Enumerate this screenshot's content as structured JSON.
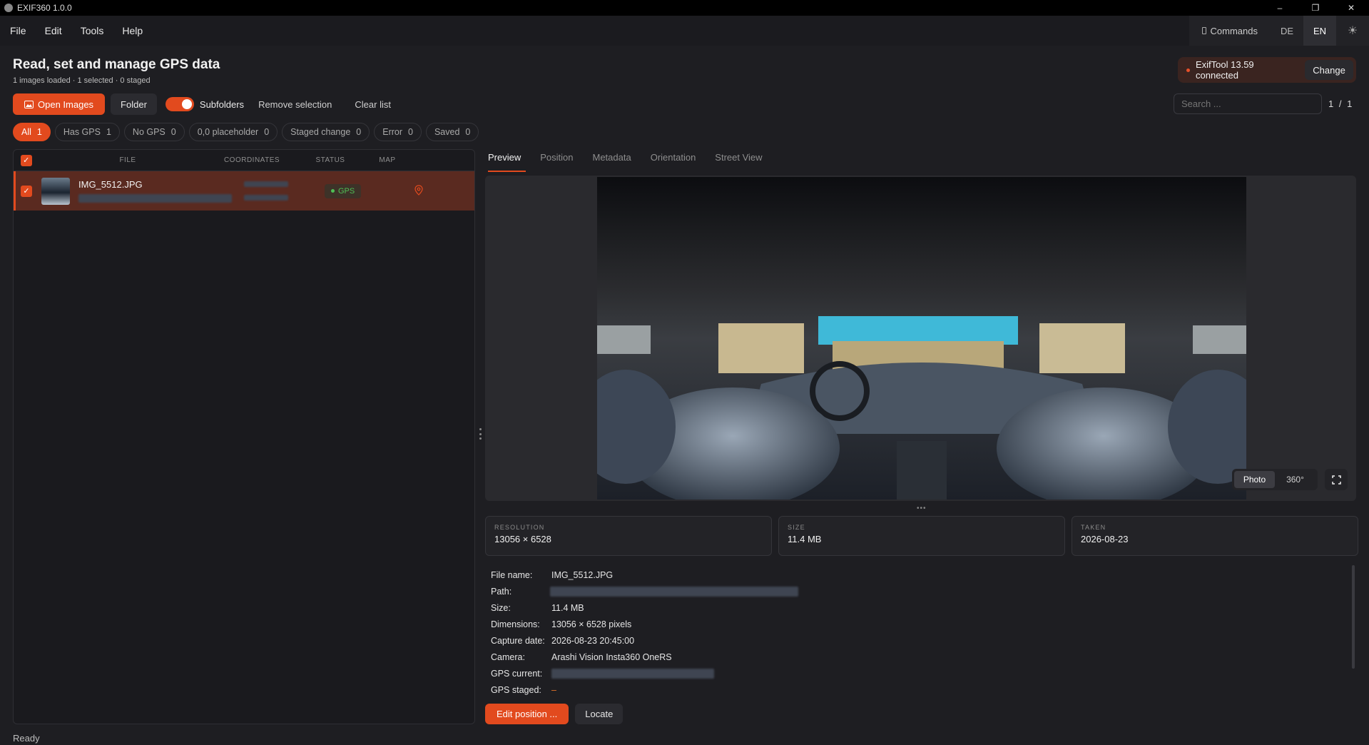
{
  "window": {
    "title": "EXIF360 1.0.0",
    "controls": [
      "–",
      "❐",
      "✕"
    ]
  },
  "menu": [
    "File",
    "Edit",
    "Tools",
    "Help"
  ],
  "topbar": {
    "commands_label": "Commands",
    "languages": [
      "DE",
      "EN"
    ],
    "active_language": "EN"
  },
  "page": {
    "title": "Read, set and manage GPS data",
    "subtitle": "1 images loaded · 1 selected · 0 staged"
  },
  "exiftool": {
    "status": "ExifTool 13.59 connected",
    "change_label": "Change"
  },
  "toolbar": {
    "open_images": "Open Images",
    "folder": "Folder",
    "subfolders": "Subfolders",
    "subfolders_on": true,
    "remove_selection": "Remove selection",
    "clear_list": "Clear list"
  },
  "search": {
    "placeholder": "Search ...",
    "pager": "1 / 1"
  },
  "filters": [
    {
      "label": "All",
      "count": "1",
      "active": true
    },
    {
      "label": "Has GPS",
      "count": "1"
    },
    {
      "label": "No GPS",
      "count": "0"
    },
    {
      "label": "0,0 placeholder",
      "count": "0"
    },
    {
      "label": "Staged change",
      "count": "0"
    },
    {
      "label": "Error",
      "count": "0"
    },
    {
      "label": "Saved",
      "count": "0"
    }
  ],
  "table": {
    "columns": [
      "FILE",
      "COORDINATES",
      "STATUS",
      "MAP"
    ],
    "rows": [
      {
        "file": "IMG_5512.JPG",
        "status": "GPS"
      }
    ]
  },
  "tabs": [
    "Preview",
    "Position",
    "Metadata",
    "Orientation",
    "Street View"
  ],
  "active_tab": "Preview",
  "viewer": {
    "modes": [
      "Photo",
      "360°"
    ],
    "active_mode": "Photo"
  },
  "cards": [
    {
      "label": "RESOLUTION",
      "value": "13056 × 6528"
    },
    {
      "label": "SIZE",
      "value": "11.4 MB"
    },
    {
      "label": "TAKEN",
      "value": "2026-08-23"
    }
  ],
  "details": [
    {
      "key": "File name:",
      "value": "IMG_5512.JPG"
    },
    {
      "key": "Path:",
      "value": ""
    },
    {
      "key": "Size:",
      "value": "11.4 MB"
    },
    {
      "key": "Dimensions:",
      "value": "13056 × 6528 pixels"
    },
    {
      "key": "Capture date:",
      "value": "2026-08-23 20:45:00"
    },
    {
      "key": "Camera:",
      "value": "Arashi Vision Insta360 OneRS"
    },
    {
      "key": "GPS current:",
      "value": ""
    },
    {
      "key": "GPS staged:",
      "value": "–"
    }
  ],
  "actions": {
    "edit_position": "Edit position ...",
    "locate": "Locate"
  },
  "statusbar": "Ready",
  "colors": {
    "accent": "#e24a1e",
    "gps_ok": "#4fbf55",
    "background": "#1e1e22"
  }
}
